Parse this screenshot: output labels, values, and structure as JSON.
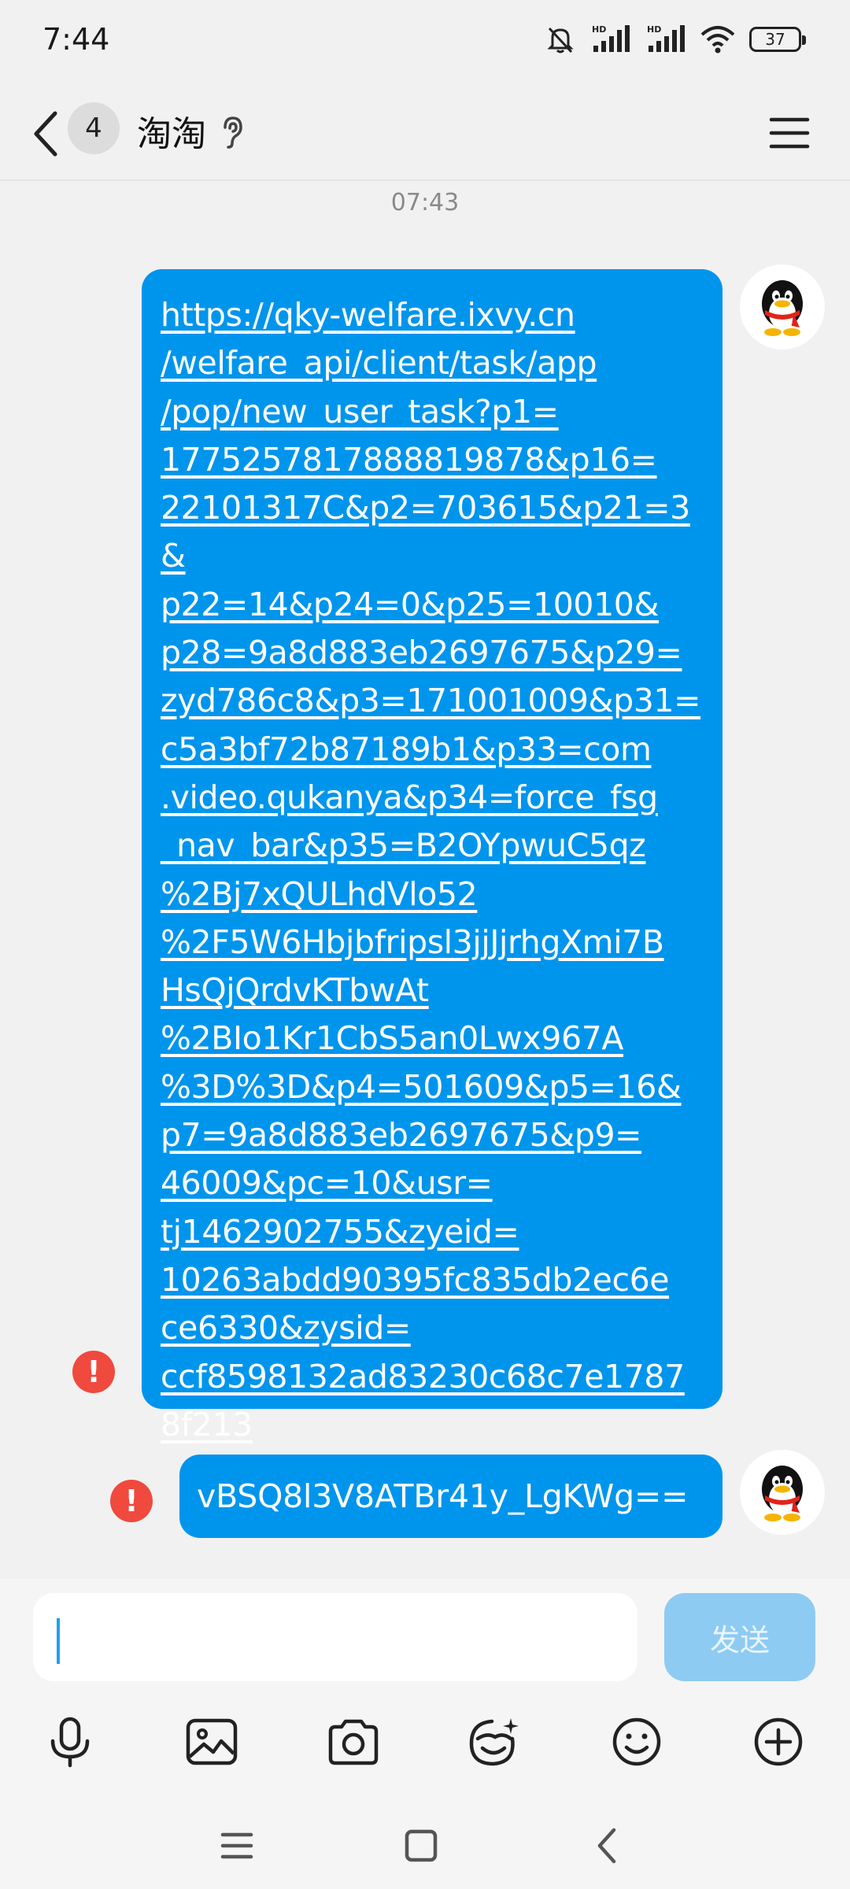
{
  "status_bar": {
    "time": "7:44",
    "battery": "37",
    "network_label": "HD"
  },
  "header": {
    "unread_count": "4",
    "contact_name": "淘淘"
  },
  "chat": {
    "timestamp": "07:43",
    "messages": [
      {
        "text": "https://qky-welfare.ixvy.cn\n/welfare_api/client/task/app\n/pop/new_user_task?p1=\n1775257817888819878&p16=\n22101317C&p2=703615&p21=3&\np22=14&p24=0&p25=10010&\np28=9a8d883eb2697675&p29=\nzyd786c8&p3=171001009&p31=\nc5a3bf72b87189b1&p33=com\n.video.qukanya&p34=force_fsg\n_nav_bar&p35=B2OYpwuC5qz\n%2Bj7xQULhdVlo52\n%2F5W6Hbjbfripsl3jjJjrhgXmi7B\nHsQjQrdvKTbwAt\n%2BIo1Kr1CbS5an0Lwx967A\n%3D%3D&p4=501609&p5=16&\np7=9a8d883eb2697675&p9=\n46009&pc=10&usr=\ntj1462902755&zyeid=\n10263abdd90395fc835db2ec6e\nce6330&zysid=\nccf8598132ad83230c68c7e1787\n8f213",
        "failed": true
      },
      {
        "text": "vBSQ8l3V8ATBr41y_LgKWg==",
        "failed": true
      }
    ]
  },
  "composer": {
    "input_value": "",
    "send_label": "发送"
  },
  "colors": {
    "bubble": "#0095ec",
    "error": "#f0493e",
    "send_disabled": "#8ecbf3"
  },
  "icons": {
    "toolbar": [
      "microphone-icon",
      "image-icon",
      "camera-icon",
      "sticker-face-icon",
      "emoji-icon",
      "plus-icon"
    ],
    "navbar": [
      "recent-apps-icon",
      "home-icon",
      "back-icon"
    ]
  }
}
